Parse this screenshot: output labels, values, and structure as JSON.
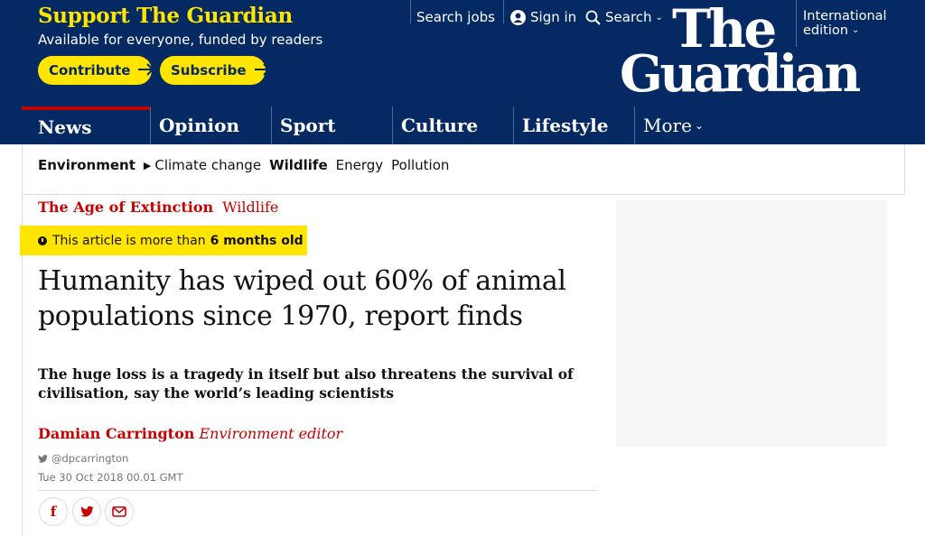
{
  "support": {
    "title": "Support The Guardian",
    "subtitle": "Available for everyone, funded by readers",
    "contribute_label": "Contribute",
    "subscribe_label": "Subscribe"
  },
  "top_links": {
    "jobs": "Search jobs",
    "signin": "Sign in",
    "search": "Search"
  },
  "edition": {
    "line1": "International",
    "line2": "edition"
  },
  "logo": {
    "line1": "The",
    "line2": "Guardian"
  },
  "nav": {
    "pillars": [
      "News",
      "Opinion",
      "Sport",
      "Culture",
      "Lifestyle",
      "More"
    ]
  },
  "subnav": {
    "items": [
      "Environment",
      "Climate change",
      "Wildlife",
      "Energy",
      "Pollution"
    ]
  },
  "article": {
    "series": "The Age of Extinction",
    "section": "Wildlife",
    "age_notice_prefix": "This article is more than",
    "age_notice_bold": "6 months old",
    "headline": "Humanity has wiped out 60% of animal populations since 1970, report finds",
    "standfirst": "The huge loss is a tragedy in itself but also threatens the survival of civilisation, say the world’s leading scientists",
    "author": "Damian Carrington",
    "role": "Environment editor",
    "twitter_handle": "@dpcarrington",
    "date": "Tue 30 Oct 2018 00.01 GMT"
  },
  "colors": {
    "brand_blue": "#052962",
    "brand_yellow": "#ffe500",
    "accent_red": "#c70000"
  },
  "icons": {
    "arrow": "arrow-right-icon",
    "user": "user-circle-icon",
    "search": "magnifier-icon",
    "chevron": "chevron-down-icon",
    "clock": "clock-icon",
    "twitter": "twitter-bird-icon",
    "facebook": "facebook-icon",
    "email": "envelope-icon"
  }
}
